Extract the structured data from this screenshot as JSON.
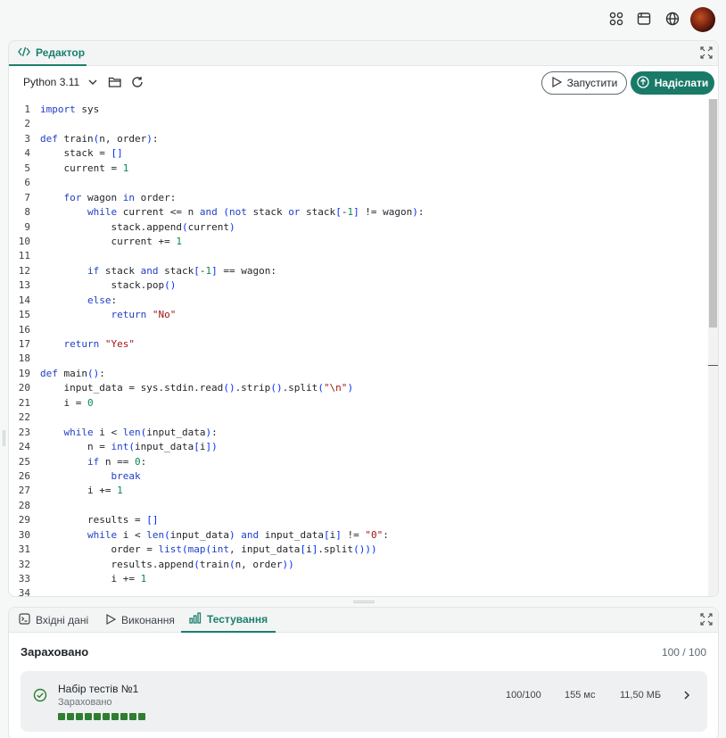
{
  "header": {
    "icons": [
      "apps-grid-icon",
      "browser-window-icon",
      "globe-icon"
    ],
    "avatar": "user-avatar"
  },
  "editor": {
    "tab_label": "Редактор",
    "language": "Python 3.11",
    "run_label": "Запустити",
    "submit_label": "Надіслати",
    "accent": "#1a7a68",
    "code_lines": [
      "import sys",
      "",
      "def train(n, order):",
      "    stack = []",
      "    current = 1",
      "",
      "    for wagon in order:",
      "        while current <= n and (not stack or stack[-1] != wagon):",
      "            stack.append(current)",
      "            current += 1",
      "",
      "        if stack and stack[-1] == wagon:",
      "            stack.pop()",
      "        else:",
      "            return \"No\"",
      "",
      "    return \"Yes\"",
      "",
      "def main():",
      "    input_data = sys.stdin.read().strip().split(\"\\n\")",
      "    i = 0",
      "",
      "    while i < len(input_data):",
      "        n = int(input_data[i])",
      "        if n == 0:",
      "            break",
      "        i += 1",
      "",
      "        results = []",
      "        while i < len(input_data) and input_data[i] != \"0\":",
      "            order = list(map(int, input_data[i].split()))",
      "            results.append(train(n, order))",
      "            i += 1",
      ""
    ]
  },
  "bottom": {
    "tabs": [
      {
        "label": "Вхідні дані",
        "icon": "terminal-icon"
      },
      {
        "label": "Виконання",
        "icon": "play-icon"
      },
      {
        "label": "Тестування",
        "icon": "bar-chart-icon"
      }
    ],
    "active_tab": 2,
    "result_title": "Зараховано",
    "result_score": "100 / 100",
    "test": {
      "name": "Набір тестів №1",
      "status": "Зараховано",
      "score": "100/100",
      "time": "155 мс",
      "memory": "11,50 МБ",
      "passed_count": 10,
      "pass_color": "#2e7d32"
    }
  }
}
